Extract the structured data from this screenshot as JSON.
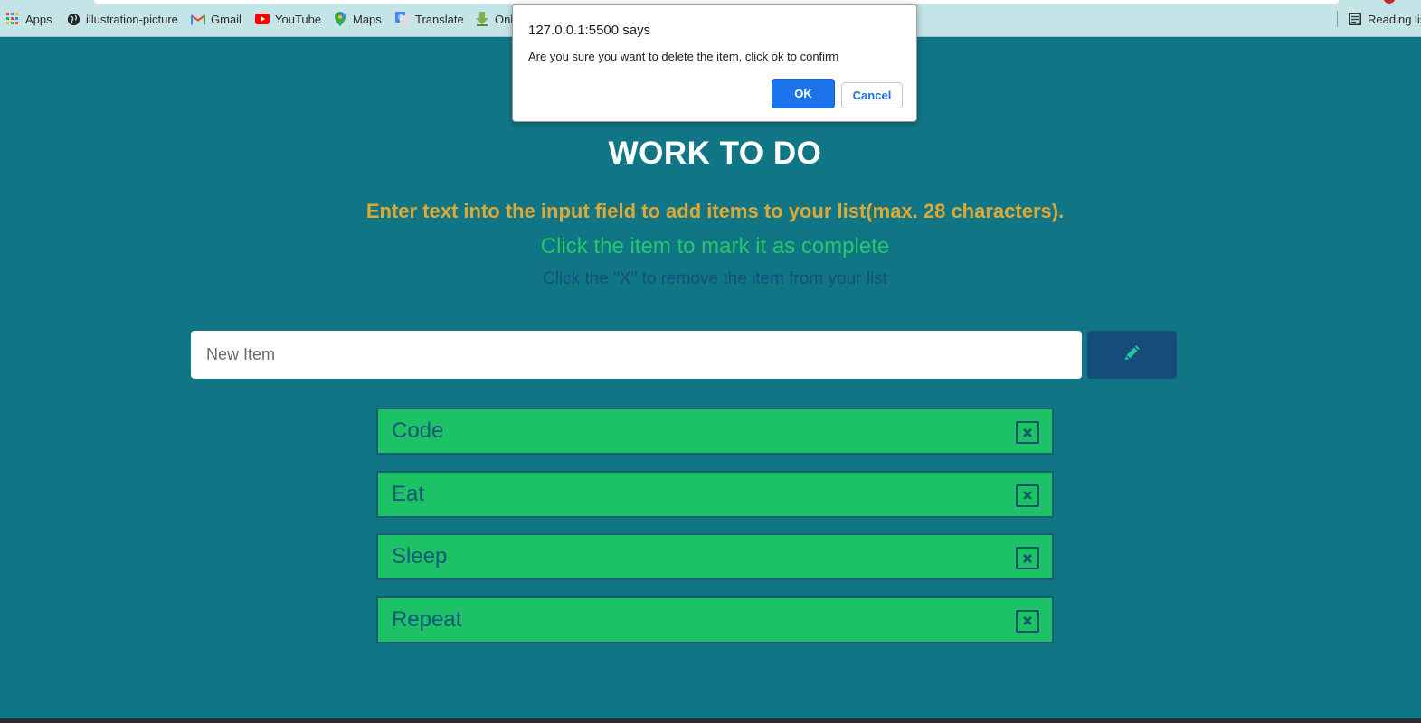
{
  "bookmarks_bar": {
    "items": [
      {
        "label": "Apps",
        "icon": "apps-grid-icon"
      },
      {
        "label": "illustration-picture",
        "icon": "globe-icon"
      },
      {
        "label": "Gmail",
        "icon": "gmail-icon"
      },
      {
        "label": "YouTube",
        "icon": "youtube-icon"
      },
      {
        "label": "Maps",
        "icon": "maps-pin-icon"
      },
      {
        "label": "Translate",
        "icon": "translate-icon"
      },
      {
        "label": "Onl",
        "icon": "download-icon"
      }
    ],
    "reading_list": {
      "label": "Reading lis",
      "icon": "reading-list-icon"
    }
  },
  "page": {
    "title": "WORK TO DO",
    "instruction_add": "Enter text into the input field to add items to your list(max. 28 characters).",
    "instruction_complete": "Click the item to mark it as complete",
    "instruction_remove": "Click the \"X\" to remove the item from your list",
    "input": {
      "placeholder": "New Item",
      "value": ""
    },
    "add_button_icon": "pencil-icon"
  },
  "todo": {
    "items": [
      {
        "label": "Code"
      },
      {
        "label": "Eat"
      },
      {
        "label": "Sleep"
      },
      {
        "label": "Repeat"
      }
    ],
    "delete_icon": "close-box-icon"
  },
  "dialog": {
    "title": "127.0.0.1:5500 says",
    "message": "Are you sure you want to delete the item, click ok to confirm",
    "ok_label": "OK",
    "cancel_label": "Cancel"
  },
  "colors": {
    "background": "#107686",
    "heading": "#ffffff",
    "instruction_add": "#dfa833",
    "instruction_complete": "#26c76a",
    "instruction_remove": "#144f7e",
    "item_fill": "#1dc266",
    "add_button": "#164c79",
    "dialog_ok": "#1a73e8"
  }
}
